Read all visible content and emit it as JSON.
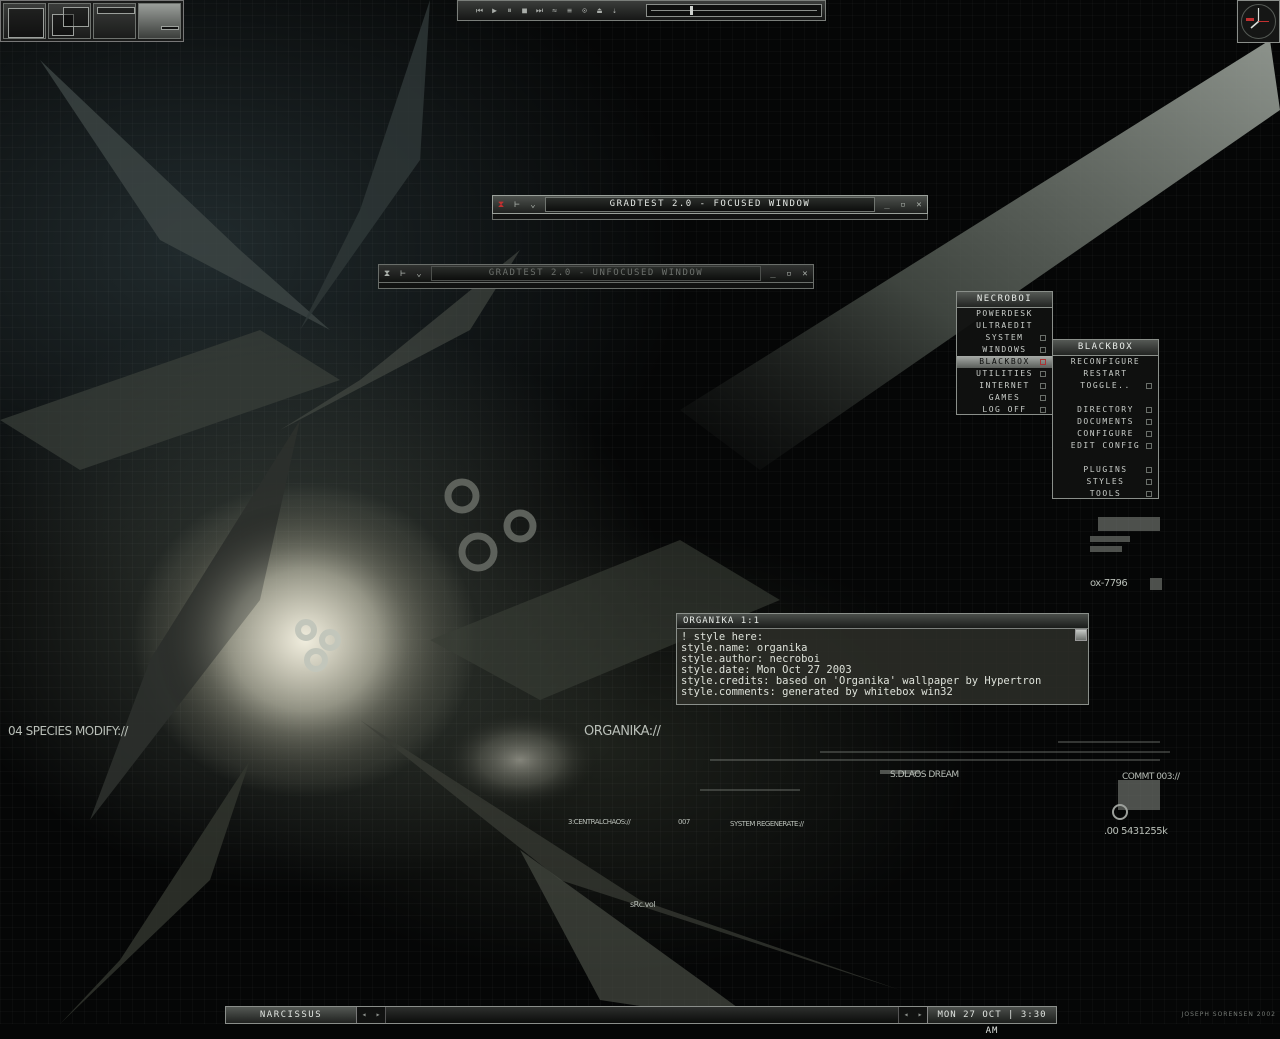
{
  "windows": {
    "focused": {
      "title": "GRADTEST 2.0 - FOCUSED WINDOW"
    },
    "unfocused": {
      "title": "GRADTEST 2.0 - UNFOCUSED WINDOW"
    }
  },
  "root_menu": {
    "title": "NECROBOI",
    "items": [
      "POWERDESK",
      "ULTRAEDIT",
      "SYSTEM",
      "WINDOWS",
      "BLACKBOX",
      "UTILITIES",
      "INTERNET",
      "GAMES",
      "LOG OFF"
    ]
  },
  "blackbox_menu": {
    "title": "BLACKBOX",
    "group1": [
      "RECONFIGURE",
      "RESTART",
      "TOGGLE.."
    ],
    "group2": [
      "DIRECTORY",
      "DOCUMENTS",
      "CONFIGURE",
      "EDIT CONFIG"
    ],
    "group3": [
      "PLUGINS",
      "STYLES",
      "TOOLS"
    ]
  },
  "console": {
    "title": "ORGANIKA  1:1",
    "lines": [
      "! style here:",
      "style.name: organika",
      "style.author: necroboi",
      "style.date: Mon Oct 27 2003",
      "style.credits: based on 'Organika' wallpaper by Hypertron",
      "style.comments: generated by whitebox win32"
    ]
  },
  "taskbar": {
    "task": "NARCISSUS",
    "clock": "MON 27 OCT | 3:30 AM"
  },
  "wallpaper_text": {
    "species": "04 SPECIES MODIFY://",
    "organika": "ORGANIKA://",
    "central": "3:CENTRALCHAOS://",
    "n007": "007",
    "regen": "SYSTEM REGENERATE://",
    "dream": "S.DLAOS DREAM",
    "comm": "COMMT 003://",
    "count": ".00 5431255k",
    "src": "sRc.vol",
    "ox": "ox-7796",
    "credit": "JOSEPH SORENSEN 2002"
  },
  "colors": {
    "accent": "#c8ccc8",
    "highlight_marker": "#aa3333"
  }
}
